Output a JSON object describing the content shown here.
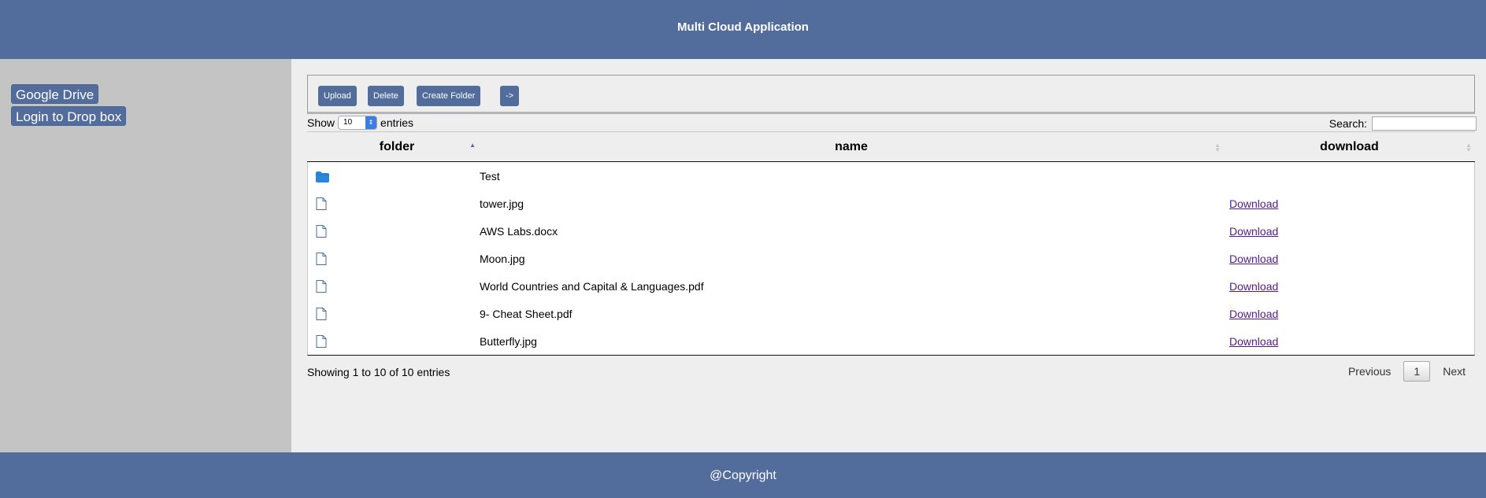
{
  "header": {
    "title": "Multi Cloud Application"
  },
  "sidebar": {
    "items": [
      {
        "label": "Google Drive"
      },
      {
        "label": "Login to Drop box"
      }
    ]
  },
  "toolbar": {
    "upload_label": "Upload",
    "delete_label": "Delete",
    "create_folder_label": "Create Folder",
    "next_label": "->"
  },
  "length_control": {
    "prefix": "Show",
    "value": "10",
    "suffix": "entries"
  },
  "search": {
    "label": "Search:",
    "value": ""
  },
  "table": {
    "columns": [
      {
        "label": "folder",
        "sort": "asc"
      },
      {
        "label": "name",
        "sort": "none"
      },
      {
        "label": "download",
        "sort": "none"
      }
    ],
    "rows": [
      {
        "type": "folder-icon",
        "name": "Test",
        "download": ""
      },
      {
        "type": "file-icon",
        "name": "tower.jpg",
        "download": "Download"
      },
      {
        "type": "file-icon",
        "name": "AWS Labs.docx",
        "download": "Download"
      },
      {
        "type": "file-icon",
        "name": "Moon.jpg",
        "download": "Download"
      },
      {
        "type": "file-icon",
        "name": "World Countries and Capital & Languages.pdf",
        "download": "Download"
      },
      {
        "type": "file-icon",
        "name": "9- Cheat Sheet.pdf",
        "download": "Download"
      },
      {
        "type": "file-icon",
        "name": "Butterfly.jpg",
        "download": "Download"
      }
    ]
  },
  "info": {
    "text": "Showing 1 to 10 of 10 entries"
  },
  "pagination": {
    "previous": "Previous",
    "current": "1",
    "next": "Next"
  },
  "footer": {
    "text": "@Copyright"
  },
  "colors": {
    "brand": "#526c9c",
    "sidebar_bg": "#c4c4c4",
    "main_bg": "#eeeeee",
    "folder_icon": "#2d86d8",
    "link": "#551a8b"
  }
}
